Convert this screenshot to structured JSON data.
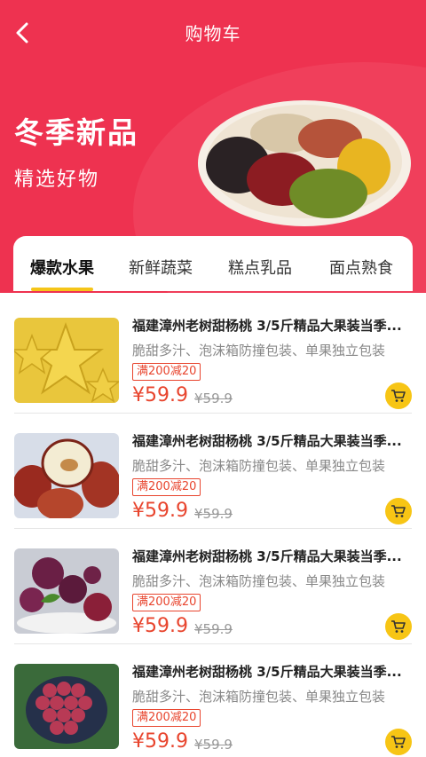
{
  "header": {
    "title": "购物车"
  },
  "banner": {
    "title": "冬季新品",
    "subtitle": "精选好物"
  },
  "tabs": [
    {
      "label": "爆款水果",
      "active": true
    },
    {
      "label": "新鲜蔬菜",
      "active": false
    },
    {
      "label": "糕点乳品",
      "active": false
    },
    {
      "label": "面点熟食",
      "active": false
    }
  ],
  "products": [
    {
      "title": "福建漳州老树甜杨桃 3/5斤精品大果装当季...",
      "desc": "脆甜多汁、泡沫箱防撞包装、单果独立包装",
      "promo": "满200减20",
      "price": "¥59.9",
      "old_price": "¥59.9",
      "image": "starfruit"
    },
    {
      "title": "福建漳州老树甜杨桃 3/5斤精品大果装当季...",
      "desc": "脆甜多汁、泡沫箱防撞包装、单果独立包装",
      "promo": "满200减20",
      "price": "¥59.9",
      "old_price": "¥59.9",
      "image": "jujube"
    },
    {
      "title": "福建漳州老树甜杨桃 3/5斤精品大果装当季...",
      "desc": "脆甜多汁、泡沫箱防撞包装、单果独立包装",
      "promo": "满200减20",
      "price": "¥59.9",
      "old_price": "¥59.9",
      "image": "bayberry"
    },
    {
      "title": "福建漳州老树甜杨桃 3/5斤精品大果装当季...",
      "desc": "脆甜多汁、泡沫箱防撞包装、单果独立包装",
      "promo": "满200减20",
      "price": "¥59.9",
      "old_price": "¥59.9",
      "image": "grapes"
    }
  ],
  "colors": {
    "hero": "#ee3250",
    "accent": "#f5c518",
    "price": "#e8452e"
  }
}
